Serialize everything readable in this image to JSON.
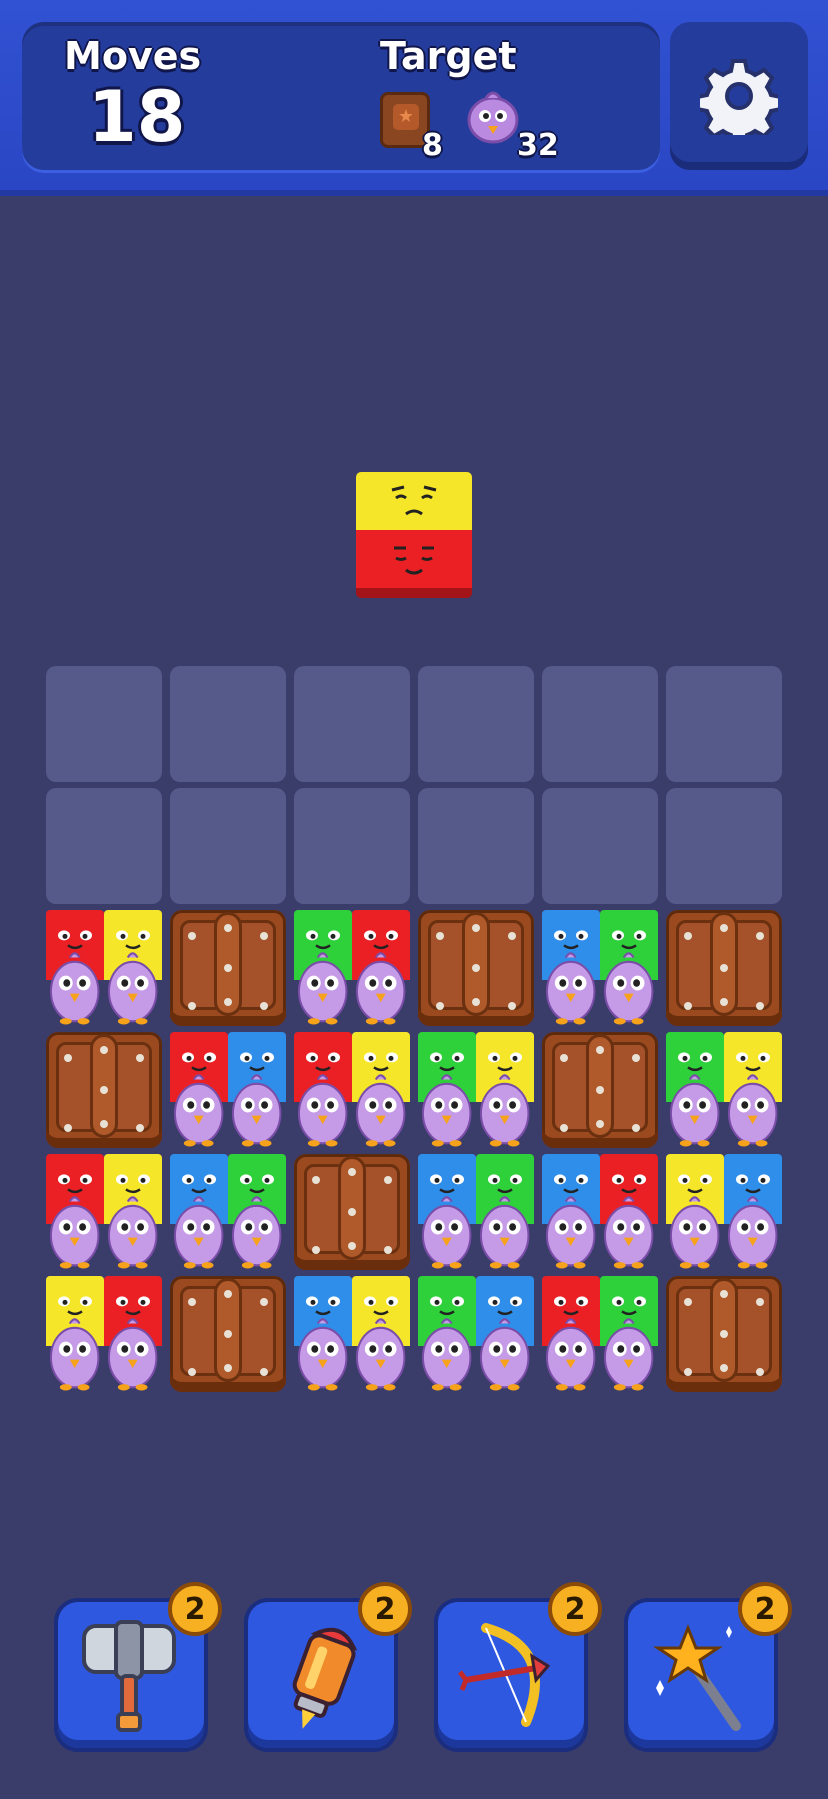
{
  "header": {
    "moves_label": "Moves",
    "moves_value": "18",
    "target_label": "Target",
    "targets": [
      {
        "icon": "crate-icon",
        "count": "8"
      },
      {
        "icon": "bird-icon",
        "count": "32"
      }
    ],
    "settings_icon": "gear-icon"
  },
  "falling_piece": {
    "top": "yellow",
    "bottom": "red"
  },
  "colors": {
    "red": "#ea2024",
    "yellow": "#f6e629",
    "green": "#2ed13a",
    "blue": "#2f8eea",
    "bird": "#c59ae6",
    "crate": "#9a4a1e"
  },
  "board": {
    "columns": 6,
    "empty_rows": 2,
    "rows": [
      [
        "tiles:red,yellow",
        "crate",
        "tiles:green,red",
        "crate",
        "tiles:blue,green",
        "crate"
      ],
      [
        "crate",
        "tiles:red,blue",
        "tiles:red,yellow",
        "tiles:green,yellow",
        "crate",
        "tiles:green,yellow"
      ],
      [
        "tiles:red,yellow",
        "tiles:blue,green",
        "crate",
        "tiles:blue,green",
        "tiles:blue,red",
        "tiles:yellow,blue"
      ],
      [
        "tiles:yellow,red",
        "crate",
        "tiles:blue,yellow",
        "tiles:green,blue",
        "tiles:red,green",
        "crate"
      ]
    ]
  },
  "boosters": [
    {
      "name": "hammer",
      "count": "2"
    },
    {
      "name": "rocket",
      "count": "2"
    },
    {
      "name": "bow",
      "count": "2"
    },
    {
      "name": "magic-wand",
      "count": "2"
    }
  ]
}
